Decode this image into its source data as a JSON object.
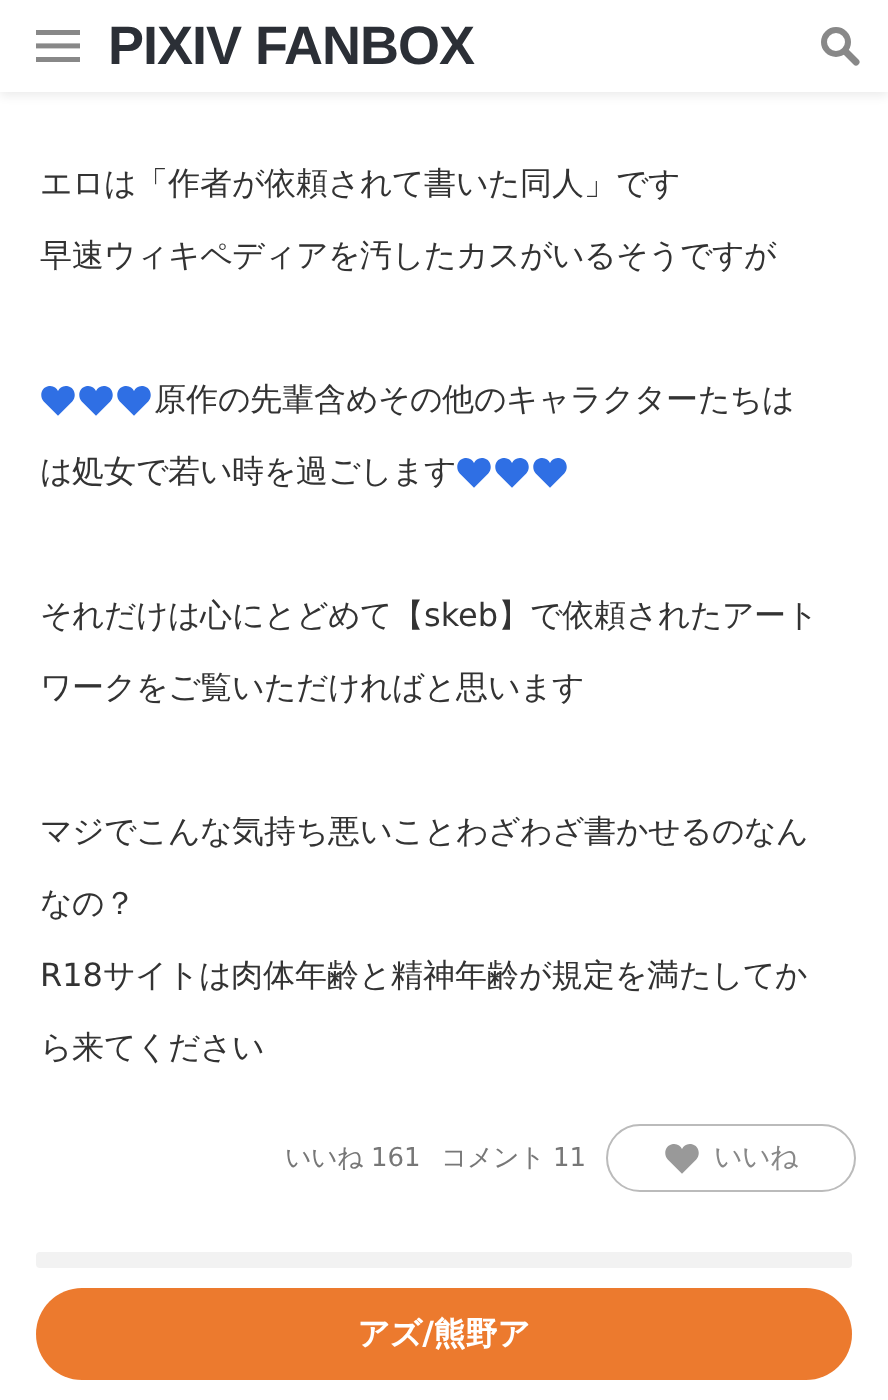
{
  "header": {
    "logo": "PIXIV FANBOX"
  },
  "paragraphs": [
    {
      "lines": [
        [
          {
            "kind": "text",
            "text": "エロは「作者が依頼されて書いた同人」です"
          }
        ],
        [
          {
            "kind": "text",
            "text": "早速ウィキペディアを汚したカスがいるそうですが"
          }
        ]
      ]
    },
    {
      "lines": [
        [
          {
            "kind": "heart"
          },
          {
            "kind": "heart"
          },
          {
            "kind": "heart"
          },
          {
            "kind": "text",
            "text": "原作の先輩含めその他のキャラクターたちは"
          }
        ],
        [
          {
            "kind": "text",
            "text": "は処女で若い時を過ごします"
          },
          {
            "kind": "heart"
          },
          {
            "kind": "heart"
          },
          {
            "kind": "heart"
          }
        ]
      ]
    },
    {
      "lines": [
        [
          {
            "kind": "text",
            "text": "それだけは心にとどめて【skeb】で依頼されたアート"
          }
        ],
        [
          {
            "kind": "text",
            "text": "ワークをご覧いただければと思います"
          }
        ]
      ]
    },
    {
      "lines": [
        [
          {
            "kind": "text",
            "text": "マジでこんな気持ち悪いことわざわざ書かせるのなん"
          }
        ],
        [
          {
            "kind": "text",
            "text": "なの？"
          }
        ],
        [
          {
            "kind": "text",
            "text": "R18サイトは肉体年齢と精神年齢が規定を満たしてか"
          }
        ],
        [
          {
            "kind": "text",
            "text": "ら来てください"
          }
        ]
      ]
    }
  ],
  "reactions": {
    "likes": "いいね 161",
    "comments": "コメント 11",
    "like_button": {
      "label": "いいね",
      "liked": false
    }
  },
  "creator_button": {
    "label": "アズ/熊野ア"
  }
}
